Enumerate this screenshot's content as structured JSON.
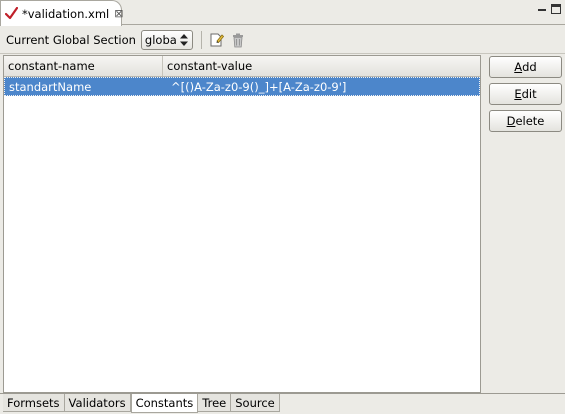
{
  "editor_tab": {
    "title": "*validation.xml",
    "close_glyph": "⊠",
    "icon": "checkmark-icon"
  },
  "window_controls": {
    "minimize_icon": "minimize-icon",
    "maximize_icon": "maximize-icon"
  },
  "toolbar": {
    "section_label": "Current Global Section",
    "section_value": "globa",
    "new_icon": "new-item-icon",
    "delete_icon": "trash-icon"
  },
  "table": {
    "columns": [
      "constant-name",
      "constant-value"
    ],
    "rows": [
      {
        "name": "standartName",
        "value": "^[()A-Za-z0-9()_]+[A-Za-z0-9']",
        "selected": true
      }
    ]
  },
  "buttons": {
    "add": {
      "mnemonic": "A",
      "rest": "dd"
    },
    "edit": {
      "mnemonic": "E",
      "rest": "dit"
    },
    "delete": {
      "mnemonic": "D",
      "rest": "elete"
    }
  },
  "page_tabs": [
    {
      "label": "Formsets",
      "active": false
    },
    {
      "label": "Validators",
      "active": false
    },
    {
      "label": "Constants",
      "active": true
    },
    {
      "label": "Tree",
      "active": false
    },
    {
      "label": "Source",
      "active": false
    }
  ],
  "colors": {
    "selection": "#4c86cb",
    "background": "#ecebe6",
    "checkmark": "#c0202a"
  }
}
